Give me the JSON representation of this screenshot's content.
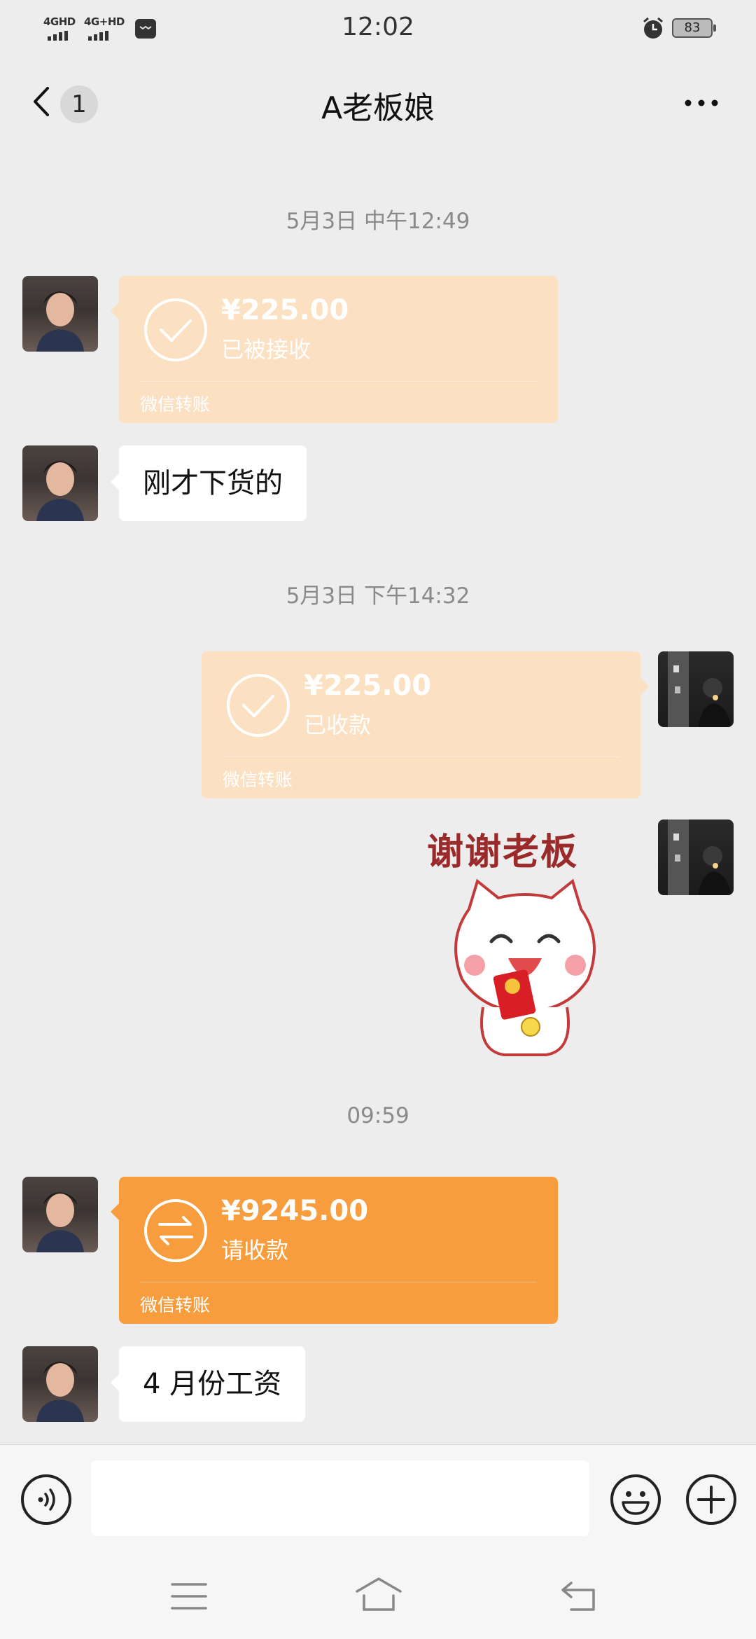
{
  "status_bar": {
    "signal1": "4GHD",
    "signal2": "4G+HD",
    "time": "12:02",
    "battery": "83"
  },
  "header": {
    "unread_count": "1",
    "title": "A老板娘"
  },
  "messages": {
    "ts1": "5月3日 中午12:49",
    "transfer1": {
      "amount": "¥225.00",
      "status": "已被接收",
      "brand": "微信转账"
    },
    "text1": "刚才下货的",
    "ts2": "5月3日 下午14:32",
    "transfer2": {
      "amount": "¥225.00",
      "status": "已收款",
      "brand": "微信转账"
    },
    "sticker_caption": "谢谢老板",
    "ts3": "09:59",
    "transfer3": {
      "amount": "¥9245.00",
      "status": "请收款",
      "brand": "微信转账"
    },
    "text2": "4 月份工资"
  },
  "input_bar": {
    "placeholder": ""
  },
  "colors": {
    "transfer_done": "#fce0c2",
    "transfer_pending": "#f89d3d",
    "background": "#ededed"
  }
}
